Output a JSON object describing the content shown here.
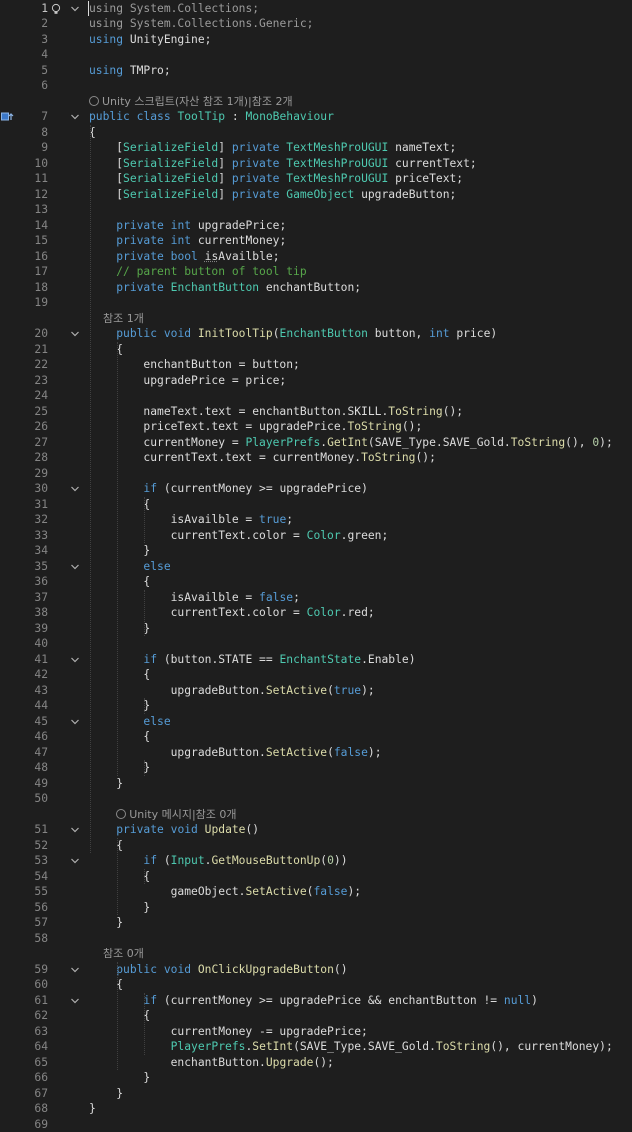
{
  "editor": {
    "language": "C#",
    "current_line": 1,
    "lines": [
      {
        "n": "1",
        "tokens": [
          {
            "t": "using",
            "c": "grey"
          },
          {
            "t": " System.Collections;",
            "c": "grey"
          }
        ],
        "fold": "open",
        "glyph": "bulb"
      },
      {
        "n": "2",
        "tokens": [
          {
            "t": "using",
            "c": "grey"
          },
          {
            "t": " System.Collections.Generic;",
            "c": "grey"
          }
        ]
      },
      {
        "n": "3",
        "tokens": [
          {
            "t": "using",
            "c": "kw"
          },
          {
            "t": " UnityEngine;"
          }
        ]
      },
      {
        "n": "4",
        "tokens": []
      },
      {
        "n": "5",
        "tokens": [
          {
            "t": "using",
            "c": "kw"
          },
          {
            "t": " TMPro;"
          }
        ]
      },
      {
        "n": "6",
        "tokens": []
      },
      {
        "lens": "Unity 스크립트(자산 참조 1개)|참조 2개",
        "icon": "unity"
      },
      {
        "n": "7",
        "tokens": [
          {
            "t": "public",
            "c": "kw"
          },
          {
            "t": " "
          },
          {
            "t": "class",
            "c": "kw"
          },
          {
            "t": " "
          },
          {
            "t": "ToolTip",
            "c": "ty"
          },
          {
            "t": " : "
          },
          {
            "t": "MonoBehaviour",
            "c": "ty"
          }
        ],
        "fold": "open",
        "glyph": "impl"
      },
      {
        "n": "8",
        "tokens": [
          {
            "t": "{"
          }
        ]
      },
      {
        "n": "9",
        "tokens": [
          {
            "t": "    [",
            "c": ""
          },
          {
            "t": "SerializeField",
            "c": "ty"
          },
          {
            "t": "] "
          },
          {
            "t": "private",
            "c": "kw"
          },
          {
            "t": " "
          },
          {
            "t": "TextMeshProUGUI",
            "c": "ty"
          },
          {
            "t": " nameText;"
          }
        ]
      },
      {
        "n": "10",
        "tokens": [
          {
            "t": "    ["
          },
          {
            "t": "SerializeField",
            "c": "ty"
          },
          {
            "t": "] "
          },
          {
            "t": "private",
            "c": "kw"
          },
          {
            "t": " "
          },
          {
            "t": "TextMeshProUGUI",
            "c": "ty"
          },
          {
            "t": " currentText;"
          }
        ]
      },
      {
        "n": "11",
        "tokens": [
          {
            "t": "    ["
          },
          {
            "t": "SerializeField",
            "c": "ty"
          },
          {
            "t": "] "
          },
          {
            "t": "private",
            "c": "kw"
          },
          {
            "t": " "
          },
          {
            "t": "TextMeshProUGUI",
            "c": "ty"
          },
          {
            "t": " priceText;"
          }
        ]
      },
      {
        "n": "12",
        "tokens": [
          {
            "t": "    ["
          },
          {
            "t": "SerializeField",
            "c": "ty"
          },
          {
            "t": "] "
          },
          {
            "t": "private",
            "c": "kw"
          },
          {
            "t": " "
          },
          {
            "t": "GameObject",
            "c": "ty"
          },
          {
            "t": " upgradeButton;"
          }
        ]
      },
      {
        "n": "13",
        "tokens": []
      },
      {
        "n": "14",
        "tokens": [
          {
            "t": "    "
          },
          {
            "t": "private",
            "c": "kw"
          },
          {
            "t": " "
          },
          {
            "t": "int",
            "c": "kw"
          },
          {
            "t": " upgradePrice;"
          }
        ]
      },
      {
        "n": "15",
        "tokens": [
          {
            "t": "    "
          },
          {
            "t": "private",
            "c": "kw"
          },
          {
            "t": " "
          },
          {
            "t": "int",
            "c": "kw"
          },
          {
            "t": " currentMoney;"
          }
        ]
      },
      {
        "n": "16",
        "tokens": [
          {
            "t": "    "
          },
          {
            "t": "private",
            "c": "kw"
          },
          {
            "t": " "
          },
          {
            "t": "bool",
            "c": "kw"
          },
          {
            "t": " "
          },
          {
            "t": "is",
            "c": "squig"
          },
          {
            "t": "Availble;"
          }
        ]
      },
      {
        "n": "17",
        "tokens": [
          {
            "t": "    "
          },
          {
            "t": "// parent button of tool tip",
            "c": "cm"
          }
        ]
      },
      {
        "n": "18",
        "tokens": [
          {
            "t": "    "
          },
          {
            "t": "private",
            "c": "kw"
          },
          {
            "t": " "
          },
          {
            "t": "EnchantButton",
            "c": "ty"
          },
          {
            "t": " enchantButton;"
          }
        ]
      },
      {
        "n": "19",
        "tokens": []
      },
      {
        "lens": "    참조 1개"
      },
      {
        "n": "20",
        "tokens": [
          {
            "t": "    "
          },
          {
            "t": "public",
            "c": "kw"
          },
          {
            "t": " "
          },
          {
            "t": "void",
            "c": "kw"
          },
          {
            "t": " "
          },
          {
            "t": "InitToolTip",
            "c": "fn"
          },
          {
            "t": "("
          },
          {
            "t": "EnchantButton",
            "c": "ty"
          },
          {
            "t": " button, "
          },
          {
            "t": "int",
            "c": "kw"
          },
          {
            "t": " price)"
          }
        ],
        "fold": "open"
      },
      {
        "n": "21",
        "tokens": [
          {
            "t": "    {"
          }
        ]
      },
      {
        "n": "22",
        "tokens": [
          {
            "t": "        enchantButton = button;"
          }
        ]
      },
      {
        "n": "23",
        "tokens": [
          {
            "t": "        upgradePrice = price;"
          }
        ]
      },
      {
        "n": "24",
        "tokens": []
      },
      {
        "n": "25",
        "tokens": [
          {
            "t": "        nameText.text = enchantButton.SKILL."
          },
          {
            "t": "ToString",
            "c": "fn"
          },
          {
            "t": "();"
          }
        ]
      },
      {
        "n": "26",
        "tokens": [
          {
            "t": "        priceText.text = upgradePrice."
          },
          {
            "t": "ToString",
            "c": "fn"
          },
          {
            "t": "();"
          }
        ]
      },
      {
        "n": "27",
        "tokens": [
          {
            "t": "        currentMoney = "
          },
          {
            "t": "PlayerPrefs",
            "c": "ty"
          },
          {
            "t": "."
          },
          {
            "t": "GetInt",
            "c": "fn"
          },
          {
            "t": "(SAVE_Type.SAVE_Gold."
          },
          {
            "t": "ToString",
            "c": "fn"
          },
          {
            "t": "(), "
          },
          {
            "t": "0",
            "c": "num"
          },
          {
            "t": ");"
          }
        ]
      },
      {
        "n": "28",
        "tokens": [
          {
            "t": "        currentText.text = currentMoney."
          },
          {
            "t": "ToString",
            "c": "fn"
          },
          {
            "t": "();"
          }
        ]
      },
      {
        "n": "29",
        "tokens": []
      },
      {
        "n": "30",
        "tokens": [
          {
            "t": "        "
          },
          {
            "t": "if",
            "c": "kw"
          },
          {
            "t": " (currentMoney >= upgradePrice)"
          }
        ],
        "fold": "open"
      },
      {
        "n": "31",
        "tokens": [
          {
            "t": "        {"
          }
        ]
      },
      {
        "n": "32",
        "tokens": [
          {
            "t": "            isAvailble = "
          },
          {
            "t": "true",
            "c": "kw"
          },
          {
            "t": ";"
          }
        ]
      },
      {
        "n": "33",
        "tokens": [
          {
            "t": "            currentText.color = "
          },
          {
            "t": "Color",
            "c": "ty"
          },
          {
            "t": ".green;"
          }
        ]
      },
      {
        "n": "34",
        "tokens": [
          {
            "t": "        }"
          }
        ]
      },
      {
        "n": "35",
        "tokens": [
          {
            "t": "        "
          },
          {
            "t": "else",
            "c": "kw"
          }
        ],
        "fold": "open"
      },
      {
        "n": "36",
        "tokens": [
          {
            "t": "        {"
          }
        ]
      },
      {
        "n": "37",
        "tokens": [
          {
            "t": "            isAvailble = "
          },
          {
            "t": "false",
            "c": "kw"
          },
          {
            "t": ";"
          }
        ]
      },
      {
        "n": "38",
        "tokens": [
          {
            "t": "            currentText.color = "
          },
          {
            "t": "Color",
            "c": "ty"
          },
          {
            "t": ".red;"
          }
        ]
      },
      {
        "n": "39",
        "tokens": [
          {
            "t": "        }"
          }
        ]
      },
      {
        "n": "40",
        "tokens": []
      },
      {
        "n": "41",
        "tokens": [
          {
            "t": "        "
          },
          {
            "t": "if",
            "c": "kw"
          },
          {
            "t": " (button.STATE == "
          },
          {
            "t": "EnchantState",
            "c": "ty"
          },
          {
            "t": ".Enable)"
          }
        ],
        "fold": "open"
      },
      {
        "n": "42",
        "tokens": [
          {
            "t": "        {"
          }
        ]
      },
      {
        "n": "43",
        "tokens": [
          {
            "t": "            upgradeButton."
          },
          {
            "t": "SetActive",
            "c": "fn"
          },
          {
            "t": "("
          },
          {
            "t": "true",
            "c": "kw"
          },
          {
            "t": ");"
          }
        ]
      },
      {
        "n": "44",
        "tokens": [
          {
            "t": "        }"
          }
        ]
      },
      {
        "n": "45",
        "tokens": [
          {
            "t": "        "
          },
          {
            "t": "else",
            "c": "kw"
          }
        ],
        "fold": "open"
      },
      {
        "n": "46",
        "tokens": [
          {
            "t": "        {"
          }
        ]
      },
      {
        "n": "47",
        "tokens": [
          {
            "t": "            upgradeButton."
          },
          {
            "t": "SetActive",
            "c": "fn"
          },
          {
            "t": "("
          },
          {
            "t": "false",
            "c": "kw"
          },
          {
            "t": ");"
          }
        ]
      },
      {
        "n": "48",
        "tokens": [
          {
            "t": "        }"
          }
        ]
      },
      {
        "n": "49",
        "tokens": [
          {
            "t": "    }"
          }
        ]
      },
      {
        "n": "50",
        "tokens": []
      },
      {
        "lens": "Unity 메시지|참조 0개",
        "icon": "unity",
        "indent": 4
      },
      {
        "n": "51",
        "tokens": [
          {
            "t": "    "
          },
          {
            "t": "private",
            "c": "kw"
          },
          {
            "t": " "
          },
          {
            "t": "void",
            "c": "kw"
          },
          {
            "t": " "
          },
          {
            "t": "Update",
            "c": "fn"
          },
          {
            "t": "()"
          }
        ],
        "fold": "open"
      },
      {
        "n": "52",
        "tokens": [
          {
            "t": "    {"
          }
        ]
      },
      {
        "n": "53",
        "tokens": [
          {
            "t": "        "
          },
          {
            "t": "if",
            "c": "kw"
          },
          {
            "t": " ("
          },
          {
            "t": "Input",
            "c": "ty"
          },
          {
            "t": "."
          },
          {
            "t": "GetMouseButtonUp",
            "c": "fn"
          },
          {
            "t": "("
          },
          {
            "t": "0",
            "c": "num"
          },
          {
            "t": "))"
          }
        ],
        "fold": "open"
      },
      {
        "n": "54",
        "tokens": [
          {
            "t": "        {"
          }
        ]
      },
      {
        "n": "55",
        "tokens": [
          {
            "t": "            gameObject."
          },
          {
            "t": "SetActive",
            "c": "fn"
          },
          {
            "t": "("
          },
          {
            "t": "false",
            "c": "kw"
          },
          {
            "t": ");"
          }
        ]
      },
      {
        "n": "56",
        "tokens": [
          {
            "t": "        }"
          }
        ]
      },
      {
        "n": "57",
        "tokens": [
          {
            "t": "    }"
          }
        ]
      },
      {
        "n": "58",
        "tokens": []
      },
      {
        "lens": "    참조 0개"
      },
      {
        "n": "59",
        "tokens": [
          {
            "t": "    "
          },
          {
            "t": "public",
            "c": "kw"
          },
          {
            "t": " "
          },
          {
            "t": "void",
            "c": "kw"
          },
          {
            "t": " "
          },
          {
            "t": "OnClickUpgradeButton",
            "c": "fn"
          },
          {
            "t": "()"
          }
        ],
        "fold": "open"
      },
      {
        "n": "60",
        "tokens": [
          {
            "t": "    {"
          }
        ]
      },
      {
        "n": "61",
        "tokens": [
          {
            "t": "        "
          },
          {
            "t": "if",
            "c": "kw"
          },
          {
            "t": " (currentMoney >= upgradePrice && enchantButton != "
          },
          {
            "t": "null",
            "c": "kw"
          },
          {
            "t": ")"
          }
        ],
        "fold": "open"
      },
      {
        "n": "62",
        "tokens": [
          {
            "t": "        {"
          }
        ]
      },
      {
        "n": "63",
        "tokens": [
          {
            "t": "            currentMoney -= upgradePrice;"
          }
        ]
      },
      {
        "n": "64",
        "tokens": [
          {
            "t": "            "
          },
          {
            "t": "PlayerPrefs",
            "c": "ty"
          },
          {
            "t": "."
          },
          {
            "t": "SetInt",
            "c": "fn"
          },
          {
            "t": "(SAVE_Type.SAVE_Gold."
          },
          {
            "t": "ToString",
            "c": "fn"
          },
          {
            "t": "(), currentMoney);"
          }
        ]
      },
      {
        "n": "65",
        "tokens": [
          {
            "t": "            enchantButton."
          },
          {
            "t": "Upgrade",
            "c": "fn"
          },
          {
            "t": "();"
          }
        ]
      },
      {
        "n": "66",
        "tokens": [
          {
            "t": "        }"
          }
        ]
      },
      {
        "n": "67",
        "tokens": [
          {
            "t": "    }"
          }
        ]
      },
      {
        "n": "68",
        "tokens": [
          {
            "t": "}"
          }
        ]
      },
      {
        "n": "69",
        "tokens": []
      }
    ]
  },
  "colors": {
    "background": "#1e1e1e",
    "keyword": "#569cd6",
    "type": "#4ec9b0",
    "method": "#dcdcaa",
    "number": "#b5cea8",
    "comment": "#57a64a",
    "line_number": "#858585"
  },
  "icons": {
    "bulb": "lightbulb-icon",
    "impl": "implementation-marker-icon",
    "fold": "fold-toggle-icon",
    "unity": "unity-icon"
  }
}
